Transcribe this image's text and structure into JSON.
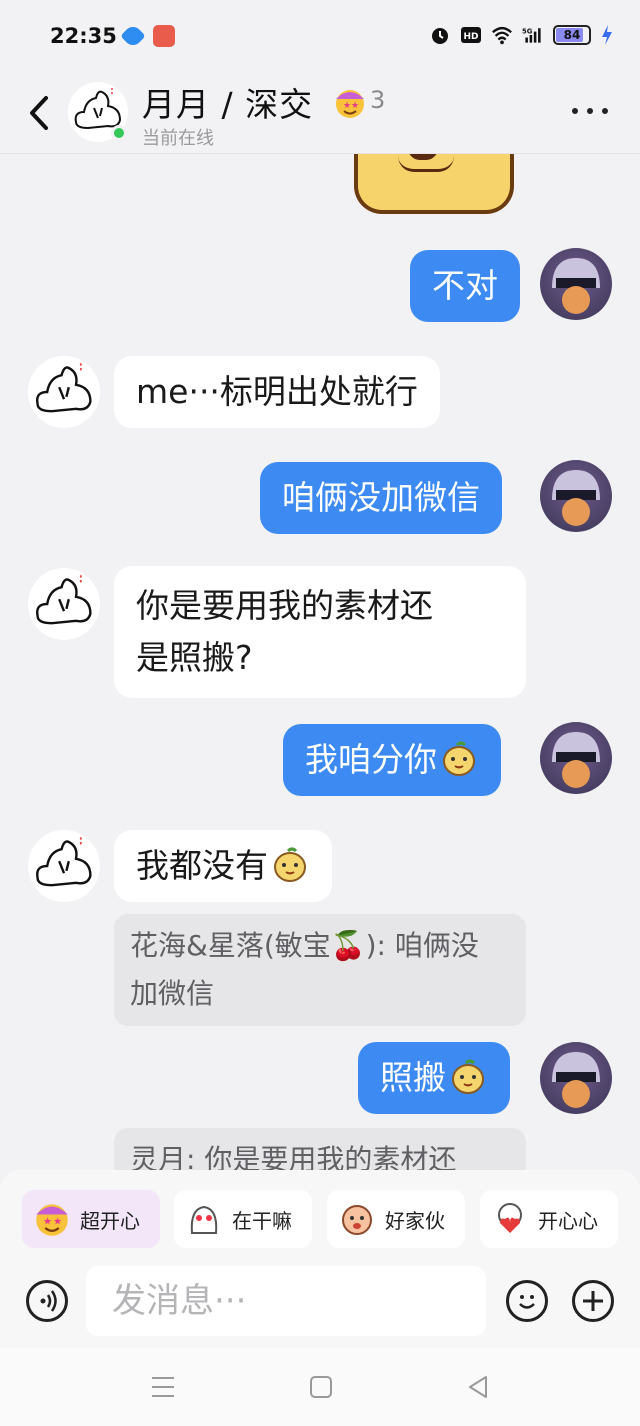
{
  "status_bar": {
    "time": "22:35",
    "battery": "84"
  },
  "header": {
    "title": "月月 / 深交",
    "badge_count": "3",
    "presence": "当前在线"
  },
  "messages": [
    {
      "side": "me",
      "text": "不对"
    },
    {
      "side": "them",
      "text": "me···标明出处就行"
    },
    {
      "side": "me",
      "text": "咱俩没加微信"
    },
    {
      "side": "them",
      "line1": "你是要用我的素材还",
      "line2": "是照搬?"
    },
    {
      "side": "me",
      "text": "我咱分你"
    },
    {
      "side": "them",
      "text": "我都没有",
      "quote_line1": "花海&星落(敏宝🍒): 咱俩没",
      "quote_line2": "加微信"
    },
    {
      "side": "me",
      "text": "照搬"
    },
    {
      "side": "them",
      "quote_line1": "灵月: 你是要用我的素材还"
    }
  ],
  "quick_replies": [
    {
      "label": "超开心"
    },
    {
      "label": "在干嘛"
    },
    {
      "label": "好家伙"
    },
    {
      "label": "开心心"
    }
  ],
  "composer": {
    "placeholder": "发消息···"
  },
  "colors": {
    "my_bubble": "#3d8bf2",
    "their_bubble": "#ffffff",
    "background": "#f2f2f4",
    "online": "#34c759"
  }
}
